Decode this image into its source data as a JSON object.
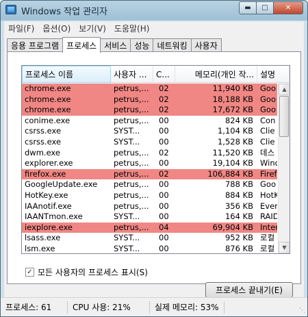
{
  "window": {
    "title": "Windows 작업 관리자"
  },
  "menu": [
    "파일(F)",
    "옵션(O)",
    "보기(V)",
    "도움말(H)"
  ],
  "tabs": [
    {
      "label": "응용 프로그램",
      "active": false
    },
    {
      "label": "프로세스",
      "active": true
    },
    {
      "label": "서비스",
      "active": false
    },
    {
      "label": "성능",
      "active": false
    },
    {
      "label": "네트워킹",
      "active": false
    },
    {
      "label": "사용자",
      "active": false
    }
  ],
  "columns": [
    "프로세스 이름",
    "사용자 ...",
    "C...",
    "메모리(개인 작...",
    "설명"
  ],
  "rows": [
    {
      "name": "chrome.exe",
      "user": "petrus,...",
      "cpu": "02",
      "mem": "11,940 KB",
      "desc": "Goo",
      "highlight": true
    },
    {
      "name": "chrome.exe",
      "user": "petrus,...",
      "cpu": "02",
      "mem": "18,188 KB",
      "desc": "Goo",
      "highlight": true
    },
    {
      "name": "chrome.exe",
      "user": "petrus,...",
      "cpu": "02",
      "mem": "17,672 KB",
      "desc": "Goo",
      "highlight": true
    },
    {
      "name": "conime.exe",
      "user": "petrus,...",
      "cpu": "00",
      "mem": "824 KB",
      "desc": "Con",
      "highlight": false
    },
    {
      "name": "csrss.exe",
      "user": "SYST...",
      "cpu": "00",
      "mem": "1,104 KB",
      "desc": "Clie",
      "highlight": false
    },
    {
      "name": "csrss.exe",
      "user": "SYST...",
      "cpu": "00",
      "mem": "1,528 KB",
      "desc": "Clie",
      "highlight": false
    },
    {
      "name": "dwm.exe",
      "user": "petrus,...",
      "cpu": "02",
      "mem": "11,520 KB",
      "desc": "데스",
      "highlight": false
    },
    {
      "name": "explorer.exe",
      "user": "petrus,...",
      "cpu": "00",
      "mem": "19,104 KB",
      "desc": "Wind",
      "highlight": false
    },
    {
      "name": "firefox.exe",
      "user": "petrus,...",
      "cpu": "02",
      "mem": "106,884 KB",
      "desc": "Firef",
      "highlight": true
    },
    {
      "name": "GoogleUpdate.exe",
      "user": "petrus,...",
      "cpu": "00",
      "mem": "788 KB",
      "desc": "Goo",
      "highlight": false
    },
    {
      "name": "HotKey.exe",
      "user": "petrus,...",
      "cpu": "00",
      "mem": "884 KB",
      "desc": "HotK",
      "highlight": false
    },
    {
      "name": "IAAnotif.exe",
      "user": "petrus,...",
      "cpu": "00",
      "mem": "356 KB",
      "desc": "Ever",
      "highlight": false
    },
    {
      "name": "IAANTmon.exe",
      "user": "SYST...",
      "cpu": "00",
      "mem": "164 KB",
      "desc": "RAID",
      "highlight": false
    },
    {
      "name": "iexplore.exe",
      "user": "petrus,...",
      "cpu": "04",
      "mem": "69,904 KB",
      "desc": "Inter",
      "highlight": true
    },
    {
      "name": "lsass.exe",
      "user": "SYST...",
      "cpu": "00",
      "mem": "952 KB",
      "desc": "로컬",
      "highlight": false
    },
    {
      "name": "lsm.exe",
      "user": "SYST...",
      "cpu": "00",
      "mem": "876 KB",
      "desc": "로컬",
      "highlight": false
    }
  ],
  "show_all_processes": {
    "label": "모든 사용자의 프로세스 표시(S)",
    "checked": true
  },
  "end_process_button": "프로세스 끝내기(E)",
  "status": {
    "processes": "프로세스: 61",
    "cpu": "CPU 사용: 21%",
    "memory": "실제 메모리: 53%"
  },
  "colors": {
    "highlight_row": "#f08784",
    "title_gradient_top": "#b9d3e2"
  }
}
